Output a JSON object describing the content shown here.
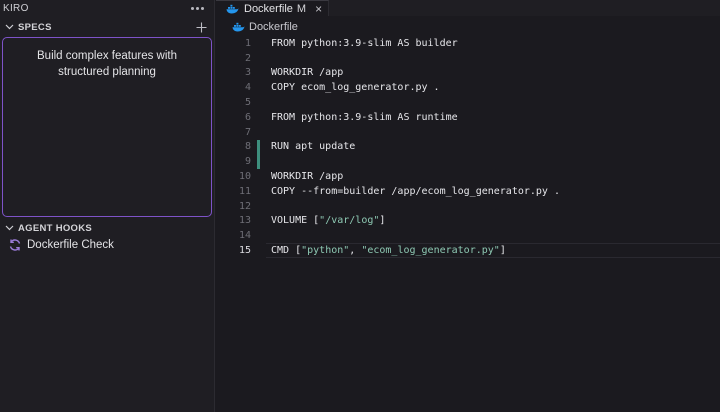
{
  "sidebar": {
    "title": "KIRO",
    "specs": {
      "label": "SPECS",
      "panel_text": "Build complex features with structured planning"
    },
    "hooks": {
      "label": "AGENT HOOKS",
      "items": [
        {
          "label": "Dockerfile Check",
          "icon": "sync-icon"
        }
      ]
    }
  },
  "editor": {
    "tab": {
      "label": "Dockerfile",
      "status": "M",
      "close": "×",
      "icon": "docker-icon"
    },
    "breadcrumb": {
      "label": "Dockerfile",
      "icon": "docker-icon"
    },
    "lines": [
      {
        "n": "1",
        "text": "FROM python:3.9-slim AS builder"
      },
      {
        "n": "2",
        "text": ""
      },
      {
        "n": "3",
        "text": "WORKDIR /app"
      },
      {
        "n": "4",
        "text": "COPY ecom_log_generator.py ."
      },
      {
        "n": "5",
        "text": ""
      },
      {
        "n": "6",
        "text": "FROM python:3.9-slim AS runtime"
      },
      {
        "n": "7",
        "text": ""
      },
      {
        "n": "8",
        "text": "RUN apt update"
      },
      {
        "n": "9",
        "text": ""
      },
      {
        "n": "10",
        "text": "WORKDIR /app"
      },
      {
        "n": "11",
        "text": "COPY --from=builder /app/ecom_log_generator.py ."
      },
      {
        "n": "12",
        "text": ""
      },
      {
        "n": "13",
        "text": "VOLUME [\"/var/log\"]"
      },
      {
        "n": "14",
        "text": ""
      },
      {
        "n": "15",
        "text": "CMD [\"python\", \"ecom_log_generator.py\"]"
      }
    ],
    "modified_lines": [
      "8",
      "9"
    ],
    "active_line": "15"
  },
  "colors": {
    "accent": "#7e53c8",
    "docker": "#2496ed",
    "modified": "#3e8f7e",
    "string": "#8ec9b3"
  }
}
